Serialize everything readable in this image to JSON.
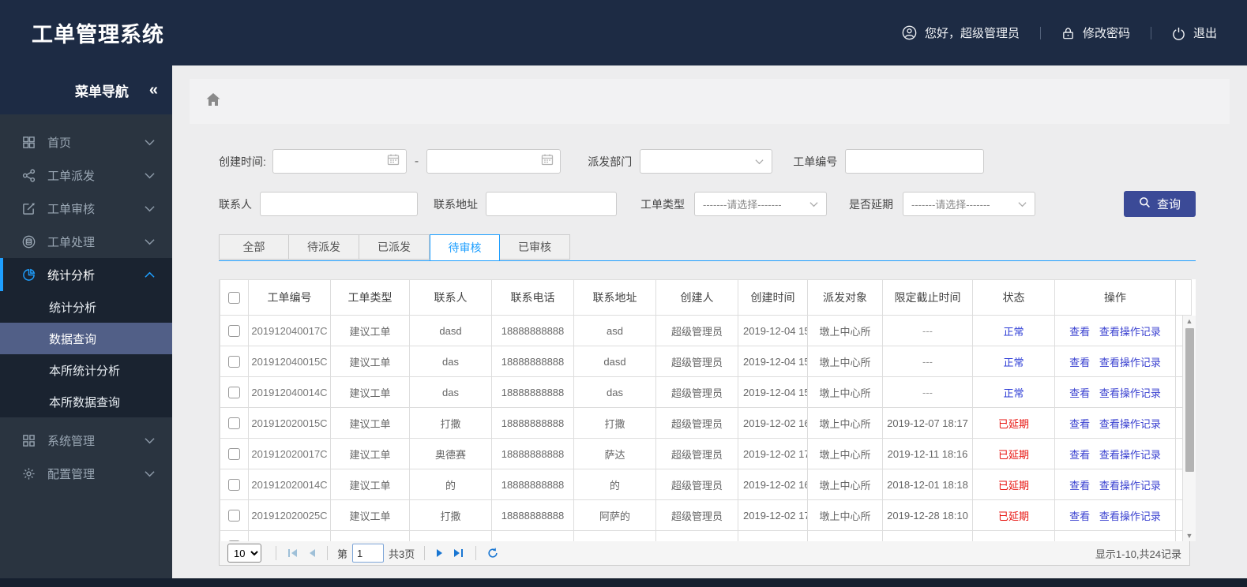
{
  "header": {
    "title": "工单管理系统",
    "greeting": "您好，超级管理员",
    "change_password": "修改密码",
    "logout": "退出"
  },
  "sidebar": {
    "title": "菜单导航",
    "collapse_glyph": "«",
    "items": [
      {
        "label": "首页"
      },
      {
        "label": "工单派发"
      },
      {
        "label": "工单审核"
      },
      {
        "label": "工单处理"
      },
      {
        "label": "统计分析"
      },
      {
        "label": "系统管理"
      },
      {
        "label": "配置管理"
      }
    ],
    "submenu": [
      "统计分析",
      "数据查询",
      "本所统计分析",
      "本所数据查询"
    ],
    "selected_submenu": "数据查询"
  },
  "filters": {
    "create_time_label": "创建时间:",
    "range_separator": "-",
    "dispatch_dept_label": "派发部门",
    "order_no_label": "工单编号",
    "contact_label": "联系人",
    "address_label": "联系地址",
    "order_type_label": "工单类型",
    "order_type_value": "-------请选择-------",
    "overdue_label": "是否延期",
    "overdue_value": "-------请选择-------",
    "search_button": "查询"
  },
  "tabs": [
    {
      "label": "全部"
    },
    {
      "label": "待派发"
    },
    {
      "label": "已派发"
    },
    {
      "label": "待审核",
      "active": true
    },
    {
      "label": "已审核"
    }
  ],
  "table": {
    "headers": [
      "工单编号",
      "工单类型",
      "联系人",
      "联系电话",
      "联系地址",
      "创建人",
      "创建时间",
      "派发对象",
      "限定截止时间",
      "状态",
      "操作"
    ],
    "actions": {
      "view": "查看",
      "view_log": "查看操作记录"
    },
    "rows": [
      {
        "order_no": "201912040017C",
        "type": "建议工单",
        "contact": "dasd",
        "phone": "18888888888",
        "address": "asd",
        "creator": "超级管理员",
        "created": "2019-12-04 15",
        "target": "墩上中心所",
        "deadline": "---",
        "status": "正常",
        "status_type": "normal"
      },
      {
        "order_no": "201912040015C",
        "type": "建议工单",
        "contact": "das",
        "phone": "18888888888",
        "address": "dasd",
        "creator": "超级管理员",
        "created": "2019-12-04 15",
        "target": "墩上中心所",
        "deadline": "---",
        "status": "正常",
        "status_type": "normal"
      },
      {
        "order_no": "201912040014C",
        "type": "建议工单",
        "contact": "das",
        "phone": "18888888888",
        "address": "das",
        "creator": "超级管理员",
        "created": "2019-12-04 15",
        "target": "墩上中心所",
        "deadline": "---",
        "status": "正常",
        "status_type": "normal"
      },
      {
        "order_no": "201912020015C",
        "type": "建议工单",
        "contact": "打撒",
        "phone": "18888888888",
        "address": "打撒",
        "creator": "超级管理员",
        "created": "2019-12-02 16",
        "target": "墩上中心所",
        "deadline": "2019-12-07 18:17",
        "status": "已延期",
        "status_type": "overdue"
      },
      {
        "order_no": "201912020017C",
        "type": "建议工单",
        "contact": "奥德赛",
        "phone": "18888888888",
        "address": "萨达",
        "creator": "超级管理员",
        "created": "2019-12-02 17",
        "target": "墩上中心所",
        "deadline": "2019-12-11 18:16",
        "status": "已延期",
        "status_type": "overdue"
      },
      {
        "order_no": "201912020014C",
        "type": "建议工单",
        "contact": "的",
        "phone": "18888888888",
        "address": "的",
        "creator": "超级管理员",
        "created": "2019-12-02 16",
        "target": "墩上中心所",
        "deadline": "2018-12-01 18:18",
        "status": "已延期",
        "status_type": "overdue"
      },
      {
        "order_no": "201912020025C",
        "type": "建议工单",
        "contact": "打撒",
        "phone": "18888888888",
        "address": "阿萨的",
        "creator": "超级管理员",
        "created": "2019-12-02 17",
        "target": "墩上中心所",
        "deadline": "2019-12-28 18:10",
        "status": "已延期",
        "status_type": "overdue"
      }
    ]
  },
  "pagination": {
    "page_size": "10",
    "page_prefix": "第",
    "page_value": "1",
    "total_pages": "共3页",
    "summary": "显示1-10,共24记录"
  }
}
